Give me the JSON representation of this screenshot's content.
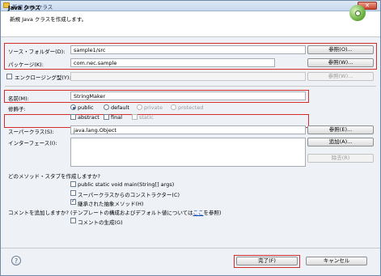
{
  "window": {
    "title": "新規 Java クラス",
    "close_label": "✕"
  },
  "header": {
    "title": "Java クラス",
    "description": "新規 Java クラスを作成します。"
  },
  "form": {
    "source_folder": {
      "label": "ソース・フォルダー(D):",
      "value": "sample1/src",
      "button": "参照(O)..."
    },
    "package": {
      "label": "パッケージ(K):",
      "value": "com.nec.sample",
      "button": "参照(W)..."
    },
    "enclosing_type": {
      "label": "エンクロージング型(Y):",
      "value": "",
      "button": "参照(W)...",
      "checked": false
    },
    "name": {
      "label": "名前(M):",
      "value": "StringMaker"
    },
    "modifiers": {
      "label": "修飾子:",
      "access": [
        {
          "label": "public",
          "selected": true,
          "enabled": true
        },
        {
          "label": "default",
          "selected": false,
          "enabled": true
        },
        {
          "label": "private",
          "selected": false,
          "enabled": false
        },
        {
          "label": "protected",
          "selected": false,
          "enabled": false
        }
      ],
      "other": [
        {
          "label": "abstract",
          "checked": false,
          "enabled": true
        },
        {
          "label": "final",
          "checked": false,
          "enabled": true
        },
        {
          "label": "static",
          "checked": false,
          "enabled": false
        }
      ]
    },
    "superclass": {
      "label": "スーパークラス(S):",
      "value": "java.lang.Object",
      "button": "参照(E)..."
    },
    "interfaces": {
      "label": "インターフェース(I):",
      "add_button": "追加(A)...",
      "remove_button": "除去(R)"
    },
    "stubs": {
      "question": "どのメソッド・スタブを作成しますか?",
      "items": [
        {
          "label": "public static void main(String[] args)",
          "checked": false
        },
        {
          "label": "スーパークラスからのコンストラクター(C)",
          "checked": false
        },
        {
          "label": "継承された抽象メソッド(H)",
          "checked": true
        }
      ]
    },
    "comments": {
      "question_before": "コメントを追加しますか? (テンプレートの構成およびデフォルト値については",
      "question_link": "ここ",
      "question_after": "を参照)",
      "generate_label": "コメントの生成(G)",
      "checked": false
    }
  },
  "footer": {
    "help_icon": "?",
    "finish": "完了(F)",
    "cancel": "キャンセル"
  }
}
